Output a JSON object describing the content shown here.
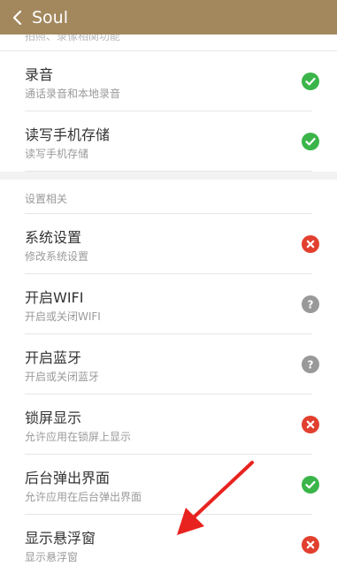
{
  "header": {
    "title": "Soul",
    "back_icon": "chevron-left-icon",
    "bg_color": "#a3885e"
  },
  "partial_item": {
    "desc": "拍照、录像相関功能"
  },
  "group1": [
    {
      "name": "录音",
      "desc": "通话录音和本地录音",
      "status": "allowed"
    },
    {
      "name": "读写手机存储",
      "desc": "读写手机存储",
      "status": "allowed"
    }
  ],
  "section": {
    "title": "设置相关"
  },
  "group2": [
    {
      "name": "系统设置",
      "desc": "修改系统设置",
      "status": "denied"
    },
    {
      "name": "开启WIFI",
      "desc": "开启或关闭WIFI",
      "status": "ask"
    },
    {
      "name": "开启蓝牙",
      "desc": "开启或关闭蓝牙",
      "status": "ask"
    },
    {
      "name": "锁屏显示",
      "desc": "允许应用在锁屏上显示",
      "status": "denied"
    },
    {
      "name": "后台弹出界面",
      "desc": "允许应用在后台弹出界面",
      "status": "allowed"
    },
    {
      "name": "显示悬浮窗",
      "desc": "显示悬浮窗",
      "status": "denied"
    }
  ],
  "colors": {
    "allowed": "#3bb54a",
    "denied": "#e2402f",
    "ask": "#999999",
    "annotation_arrow": "#e8231f"
  }
}
